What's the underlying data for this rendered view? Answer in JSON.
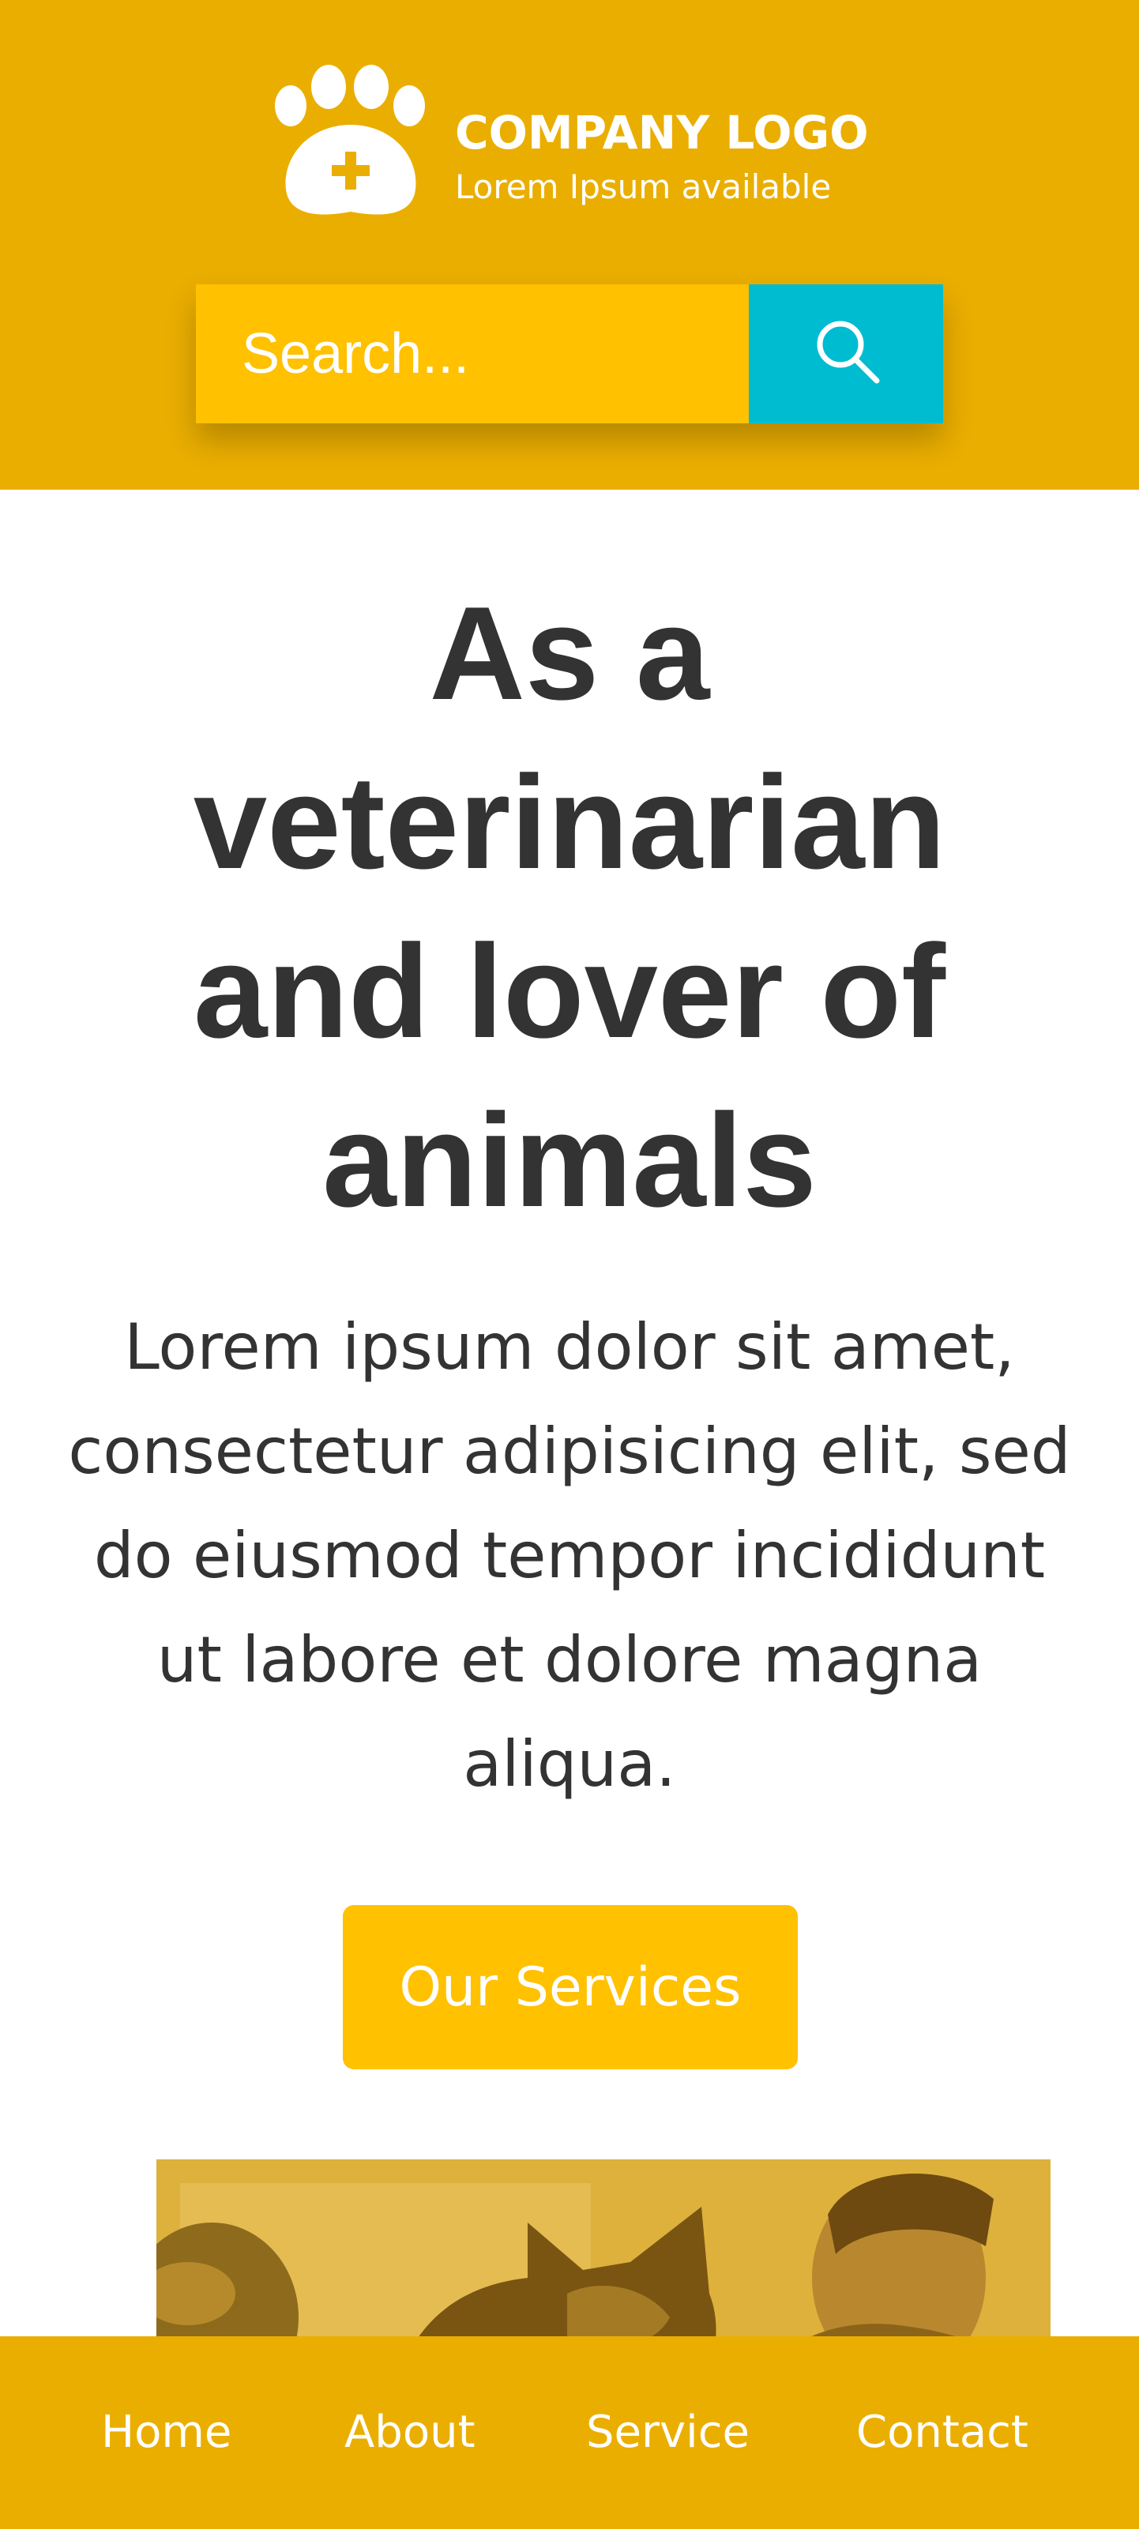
{
  "brand": {
    "title": "COMPANY LOGO",
    "subtitle": "Lorem Ipsum available",
    "icon": "paw-plus-icon",
    "primary_color": "#EAAE00",
    "accent_color": "#FFC100",
    "search_button_color": "#00BCD0"
  },
  "search": {
    "placeholder": "Search...",
    "value": "",
    "button_icon": "search-icon"
  },
  "hero": {
    "title": "As a veterinarian and lover of animals",
    "text": "Lorem ipsum dolor sit amet, consectetur adipisicing elit, sed do eiusmod tempor incididunt ut labore et dolore magna aliqua.",
    "cta_label": "Our Services"
  },
  "nav": {
    "items": [
      {
        "label": "Home"
      },
      {
        "label": "About"
      },
      {
        "label": "Service"
      },
      {
        "label": "Contact"
      }
    ]
  }
}
